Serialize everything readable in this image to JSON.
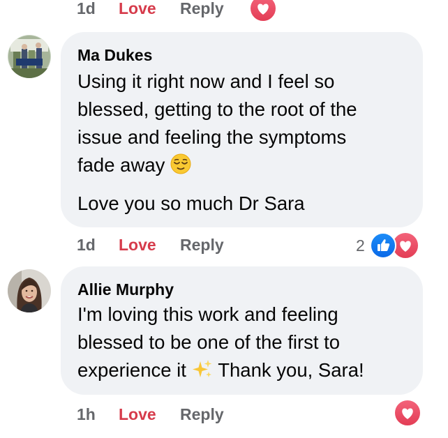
{
  "top_actions": {
    "time": "1d",
    "love_label": "Love",
    "reply_label": "Reply"
  },
  "comments": [
    {
      "author": "Ma Dukes",
      "text_lines": [
        "Using it right now and I feel so",
        "blessed, getting to the root of the",
        "issue and feeling the symptoms",
        "fade away"
      ],
      "text_emoji": "relieved-face",
      "paragraph2": "Love you so much Dr Sara",
      "time": "1d",
      "love_label": "Love",
      "reply_label": "Reply",
      "reaction_count": "2",
      "reactions": [
        "like-icon",
        "heart-icon"
      ]
    },
    {
      "author": "Allie Murphy",
      "text_lines": [
        "I'm loving this work and feeling",
        "blessed to be one of the first to"
      ],
      "last_line_before_emoji": "experience it",
      "last_line_emoji": "sparkles",
      "last_line_after_emoji": "Thank you, Sara!",
      "time": "1h",
      "love_label": "Love",
      "reply_label": "Reply",
      "reactions": [
        "heart-icon"
      ]
    }
  ],
  "colors": {
    "bubble_bg": "#f0f2f5",
    "love_red": "#d63b4b",
    "meta_gray": "#65676b",
    "like_blue": "#1877f2",
    "heart_red": "#e33d55"
  }
}
